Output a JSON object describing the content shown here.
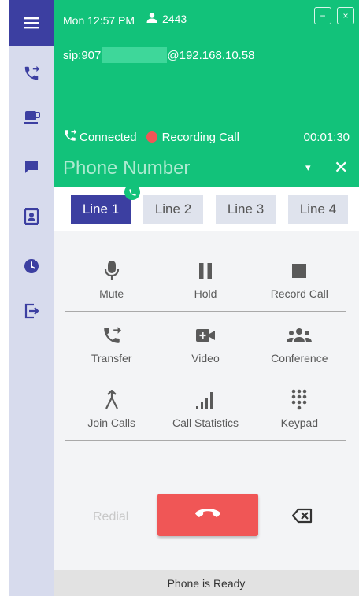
{
  "sidebar": {
    "icons": [
      "menu-icon",
      "call-transfer-icon",
      "voicemail-icon",
      "chat-icon",
      "contacts-icon",
      "history-icon",
      "logout-icon"
    ]
  },
  "header": {
    "datetime": "Mon 12:57 PM",
    "extension": "2443",
    "sip_prefix": "sip:907",
    "sip_suffix": "@192.168.10.58",
    "status": "Connected",
    "recording": "Recording Call",
    "timer": "00:01:30",
    "phone_placeholder": "Phone Number",
    "window_minimize": "−",
    "window_close": "×",
    "field_caret": "▾",
    "field_clear": "✕"
  },
  "lines": [
    {
      "label": "Line 1",
      "active": true
    },
    {
      "label": "Line 2",
      "active": false
    },
    {
      "label": "Line 3",
      "active": false
    },
    {
      "label": "Line 4",
      "active": false
    }
  ],
  "controls": {
    "mute": "Mute",
    "hold": "Hold",
    "record": "Record Call",
    "transfer": "Transfer",
    "video": "Video",
    "conference": "Conference",
    "join": "Join Calls",
    "statistics": "Call Statistics",
    "keypad": "Keypad"
  },
  "actions": {
    "redial": "Redial"
  },
  "footer": {
    "status": "Phone is Ready"
  },
  "colors": {
    "accent": "#3c3fa1",
    "green": "#12c27a",
    "red": "#f05656",
    "sidebar": "#d7dbed"
  }
}
